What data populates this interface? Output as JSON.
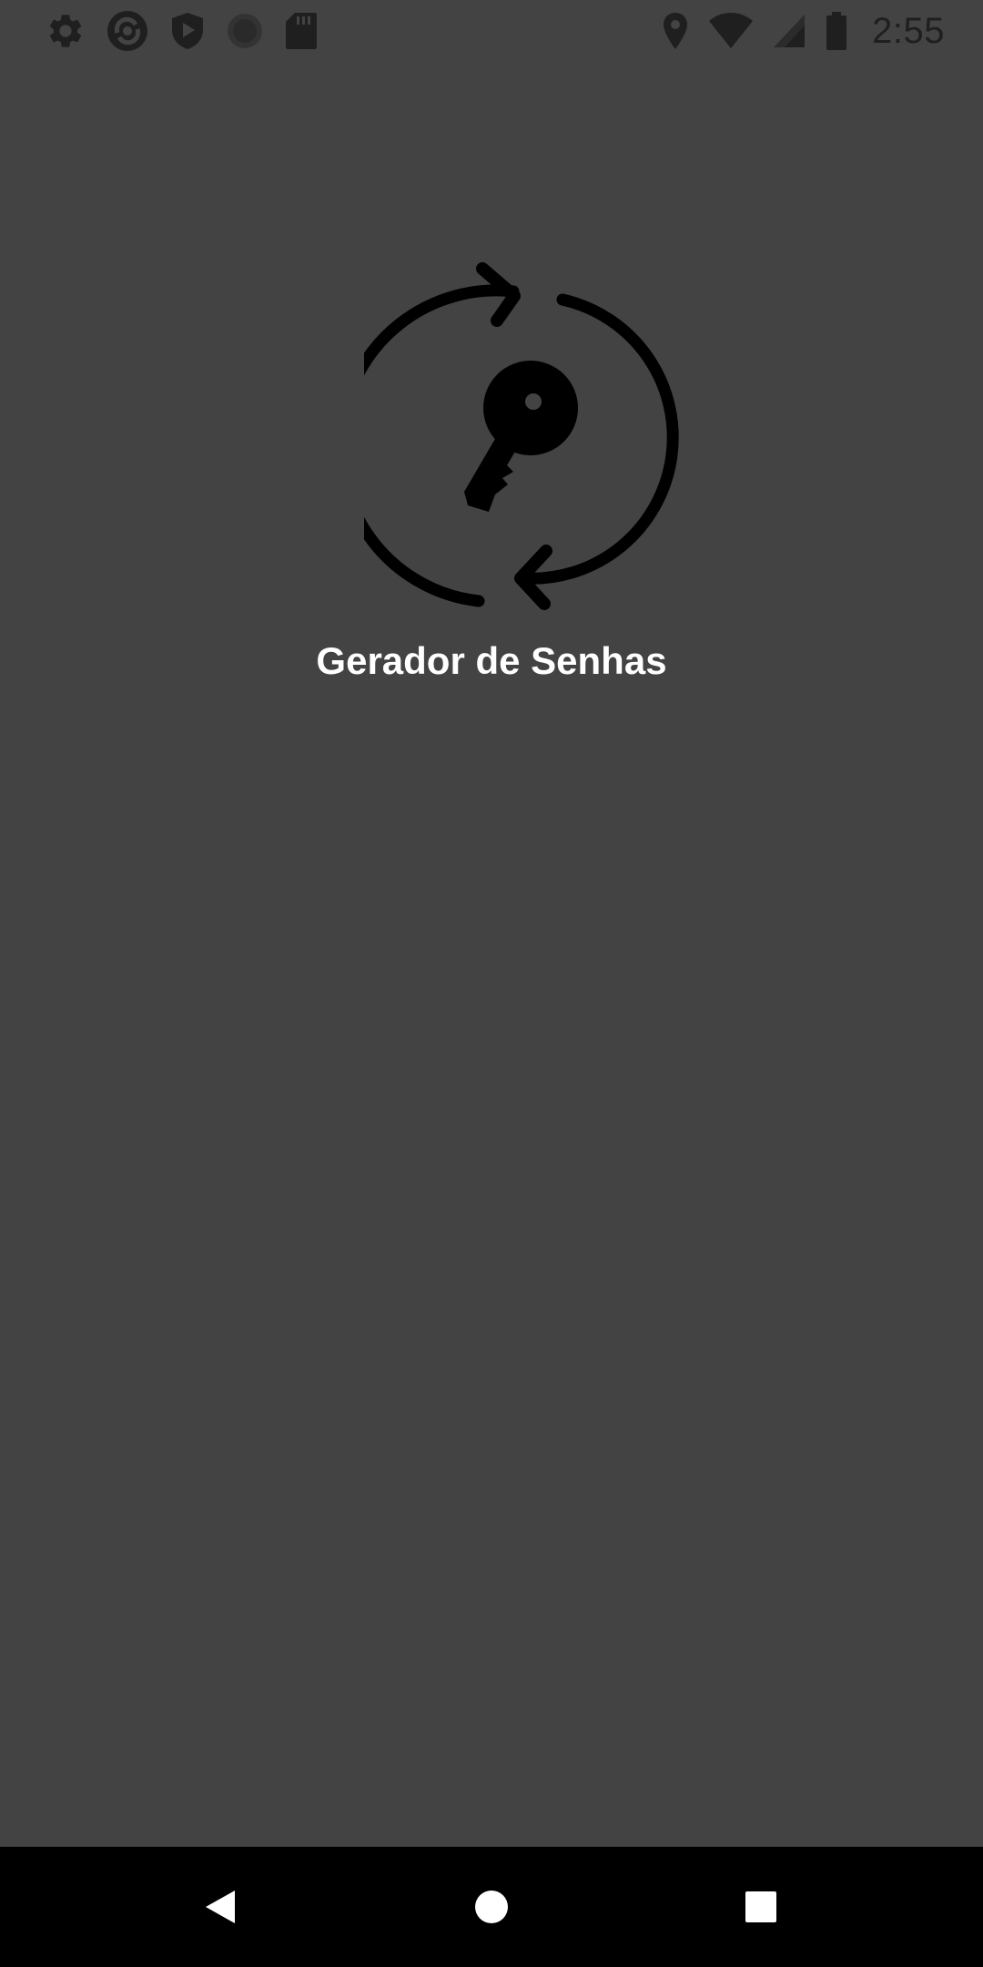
{
  "status_bar": {
    "time": "2:55",
    "left_icons": [
      "gear-icon",
      "sync-app-icon",
      "shield-play-icon",
      "circle-notification-icon",
      "sd-card-icon"
    ],
    "right_icons": [
      "location-icon",
      "wifi-icon",
      "cellular-signal-icon",
      "battery-icon"
    ]
  },
  "app": {
    "title": "Gerador de Senhas",
    "logo_icon": "key-refresh-icon"
  },
  "nav_bar": {
    "buttons": [
      "back-icon",
      "home-icon",
      "recents-icon"
    ]
  },
  "colors": {
    "background": "#434343",
    "title_text": "#ffffff",
    "icon_dark": "#000000",
    "status_icons": "#1f1f1f",
    "nav_background": "#000000",
    "nav_icons": "#ffffff"
  }
}
